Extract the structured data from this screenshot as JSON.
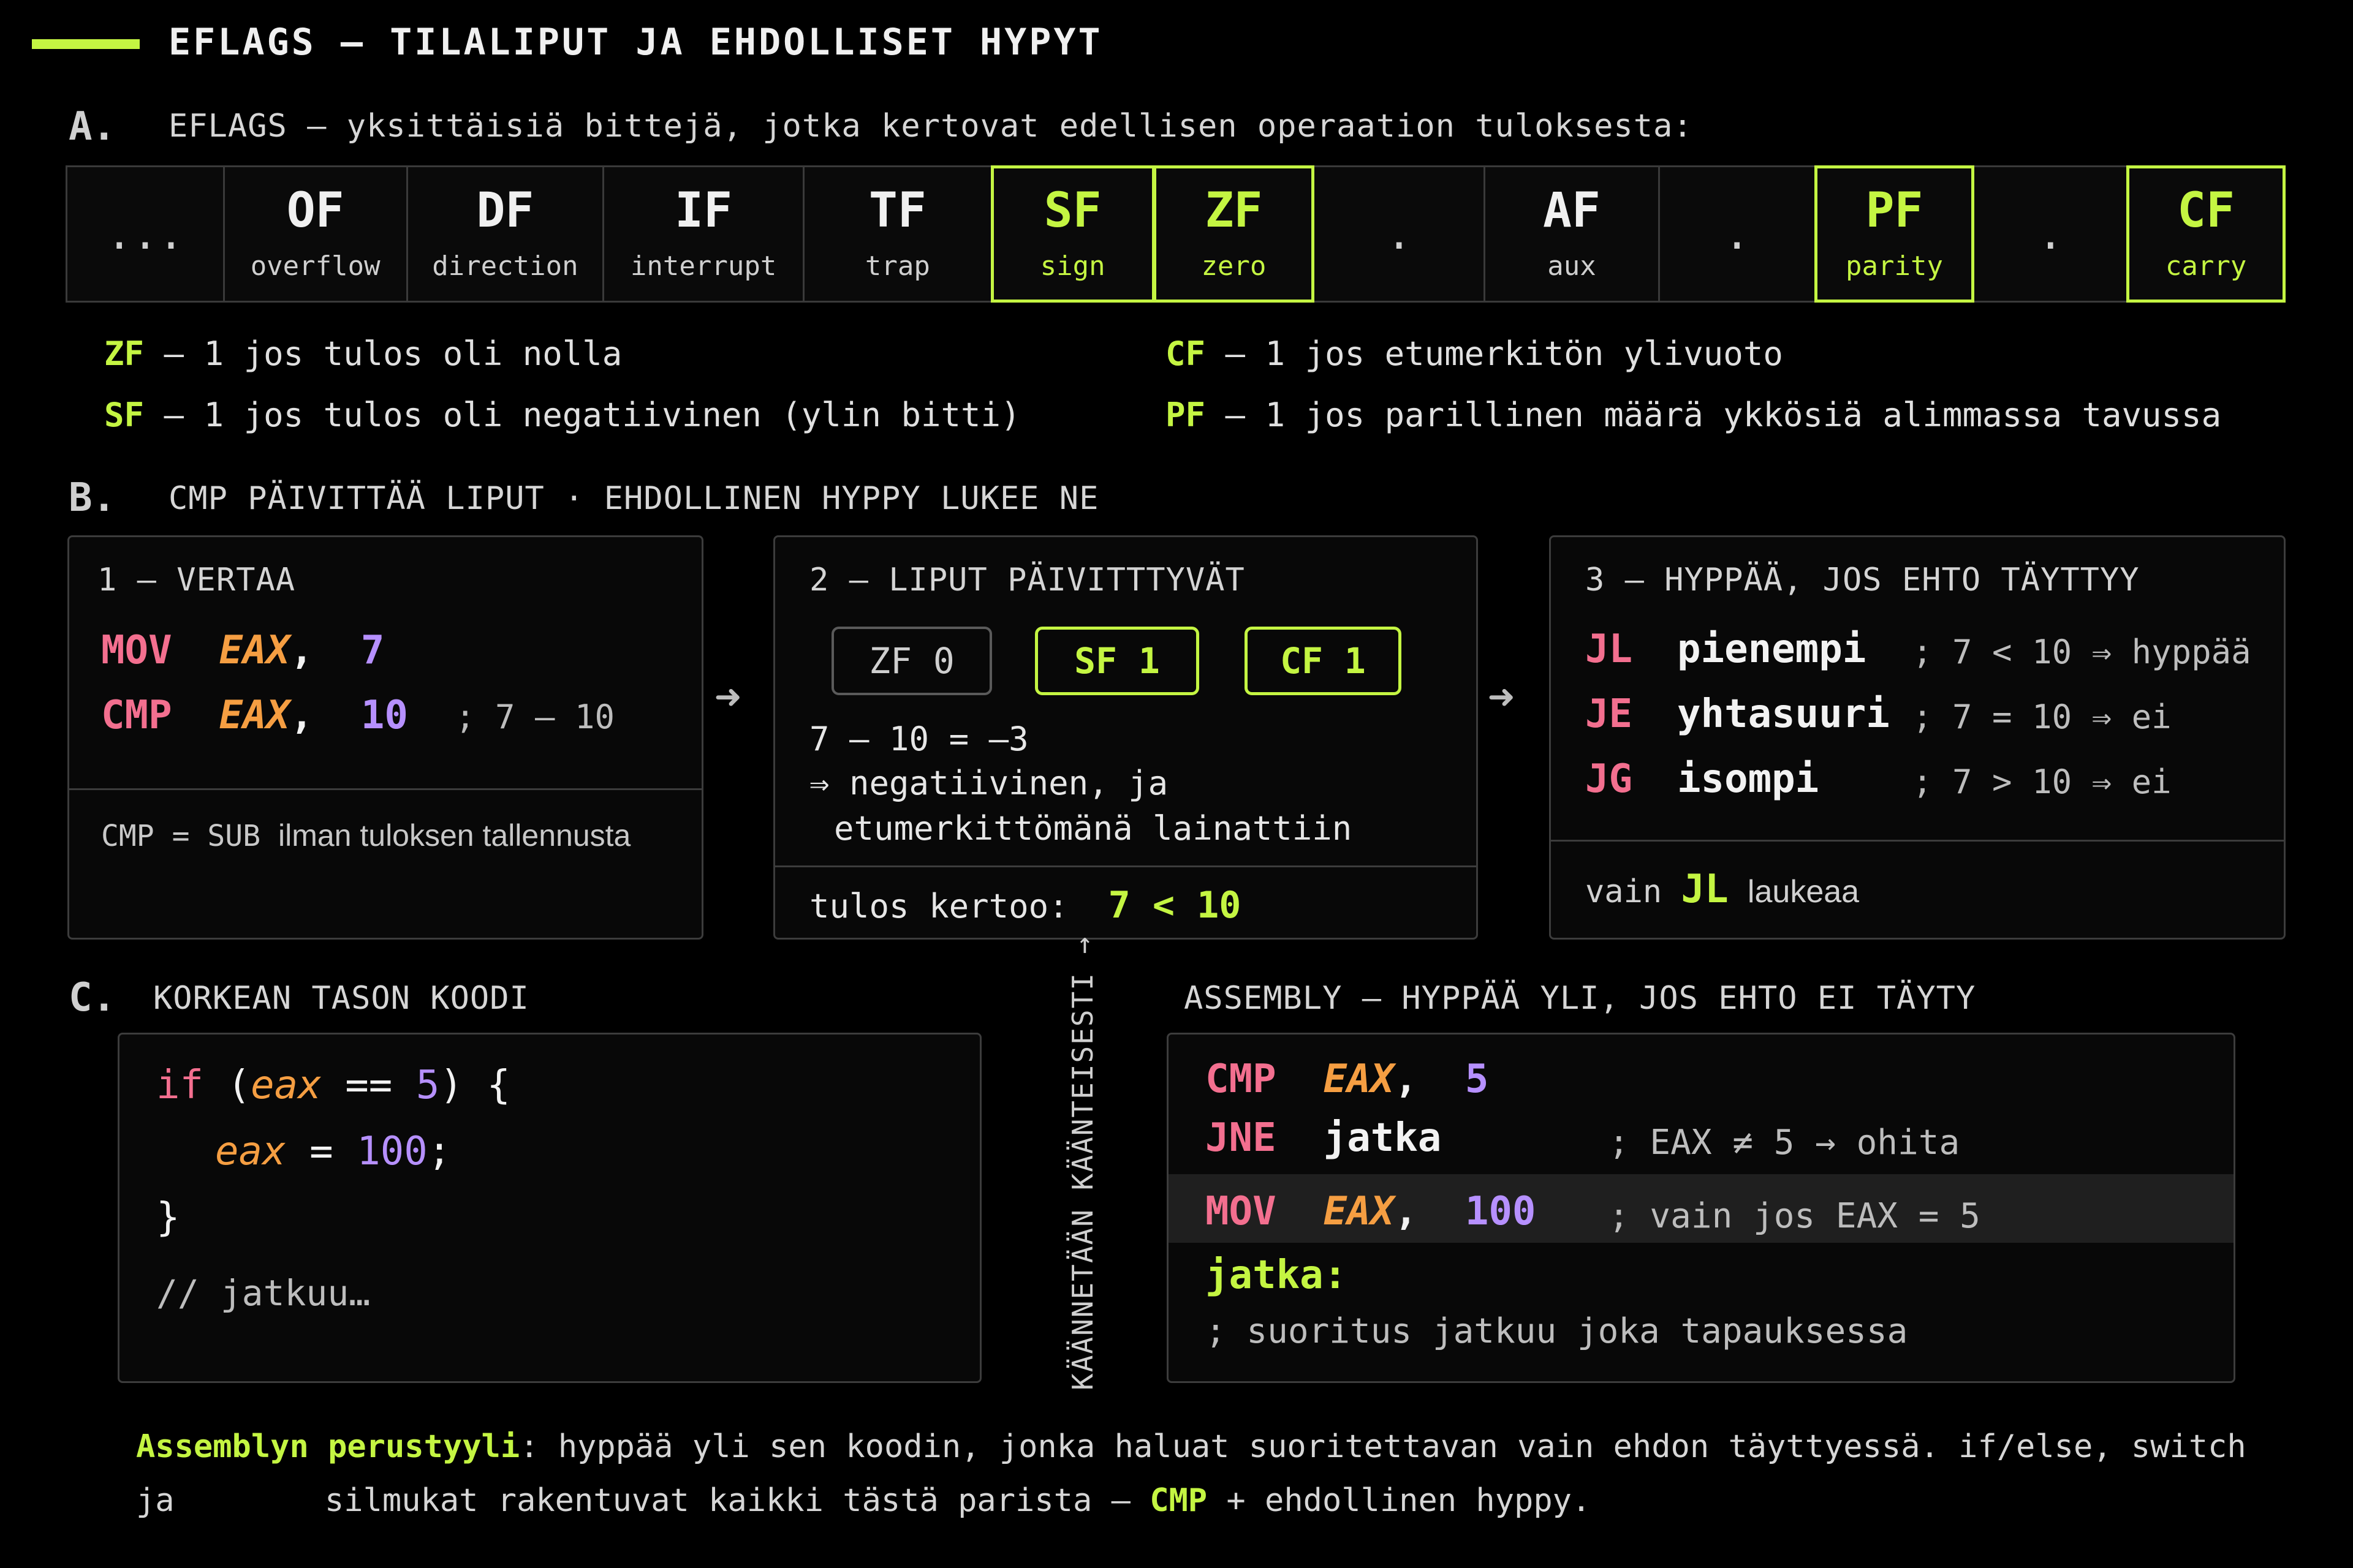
{
  "title": "EFLAGS — TILALIPUT JA EHDOLLISET HYPYT",
  "sectionA": {
    "letter": "A.",
    "heading": "EFLAGS – yksittäisiä bittejä, jotka kertovat edellisen operaation tuloksesta:",
    "flags": [
      {
        "name": "...",
        "label": "",
        "highlight": false
      },
      {
        "name": "OF",
        "label": "overflow",
        "highlight": false
      },
      {
        "name": "DF",
        "label": "direction",
        "highlight": false
      },
      {
        "name": "IF",
        "label": "interrupt",
        "highlight": false
      },
      {
        "name": "TF",
        "label": "trap",
        "highlight": false
      },
      {
        "name": "SF",
        "label": "sign",
        "highlight": true
      },
      {
        "name": "ZF",
        "label": "zero",
        "highlight": true
      },
      {
        "name": ".",
        "label": "",
        "highlight": false
      },
      {
        "name": "AF",
        "label": "aux",
        "highlight": false
      },
      {
        "name": ".",
        "label": "",
        "highlight": false
      },
      {
        "name": "PF",
        "label": "parity",
        "highlight": true
      },
      {
        "name": ".",
        "label": "",
        "highlight": false
      },
      {
        "name": "CF",
        "label": "carry",
        "highlight": true
      }
    ],
    "defs": {
      "zf_key": "ZF",
      "zf_text": " — 1 jos tulos oli nolla",
      "sf_key": "SF",
      "sf_text": " — 1 jos tulos oli negatiivinen (ylin bitti)",
      "cf_key": "CF",
      "cf_text": " — 1 jos etumerkitön ylivuoto",
      "pf_key": "PF",
      "pf_text": " — 1 jos parillinen määrä ykkösiä alimmassa tavussa"
    }
  },
  "sectionB": {
    "letter": "B.",
    "heading": "CMP PÄIVITTÄÄ LIPUT · EHDOLLINEN HYPPY LUKEE NE",
    "box1": {
      "head": "1 — VERTAA",
      "l1_op": "MOV",
      "l1_reg": "EAX",
      "l1_sep": ",",
      "l1_num": "7",
      "l2_op": "CMP",
      "l2_reg": "EAX",
      "l2_sep": ",",
      "l2_num": "10",
      "l2_cmt": "; 7 – 10",
      "foot_a": "CMP = SUB",
      "foot_b": "ilman tuloksen tallennusta"
    },
    "box2": {
      "head": "2 — LIPUT PÄIVITTTYVÄT",
      "pill1": "ZF 0",
      "pill2": "SF 1",
      "pill3": "CF 1",
      "line1": "7 – 10 = –3",
      "line2": "⇒ negatiivinen, ja",
      "line3": "etumerkittömänä lainattiin",
      "foot_a": "tulos kertoo:",
      "foot_b": "7 < 10"
    },
    "box3": {
      "head": "3 — HYPPÄÄ, JOS EHTO TÄYTTYY",
      "rows": [
        {
          "op": "JL",
          "label": "pienempi",
          "cmt": "; 7 < 10 ⇒ hyppää"
        },
        {
          "op": "JE",
          "label": "yhtasuuri",
          "cmt": "; 7 = 10 ⇒ ei"
        },
        {
          "op": "JG",
          "label": "isompi",
          "cmt": "; 7 > 10 ⇒ ei"
        }
      ],
      "foot_a": "vain",
      "foot_b": "JL",
      "foot_c": "laukeaa"
    },
    "arrow": "➜"
  },
  "sectionC": {
    "letter": "C.",
    "left_head": "KORKEAN TASON KOODI",
    "right_head": "ASSEMBLY — HYPPÄÄ YLI, JOS EHTO EI TÄYTY",
    "vertical": "KÄÄNNETÄÄN KÄÄNTEISESTI →",
    "hl": {
      "if_kw": "if",
      "p_open": " (",
      "var": "eax",
      "op": " == ",
      "num": "5",
      "p_close": ") {",
      "var2": "eax",
      "assign": " = ",
      "num2": "100",
      "semi": ";",
      "close": "}",
      "comment": "// jatkuu…"
    },
    "asm": {
      "r1_op": "CMP",
      "r1_reg": "EAX",
      "r1_sep": ",",
      "r1_num": "5",
      "r2_op": "JNE",
      "r2_lbl": "jatka",
      "r2_cmt": "; EAX ≠ 5 → ohita",
      "r3_op": "MOV",
      "r3_reg": "EAX",
      "r3_sep": ",",
      "r3_num": "100",
      "r3_cmt": "; vain jos EAX = 5",
      "r4_lbl": "jatka:",
      "r5_cmt": "; suoritus jatkuu joka tapauksessa"
    }
  },
  "footer": {
    "key": "Assemblyn perustyyli",
    "t1": ": hyppää yli sen koodin, jonka haluat suoritettavan vain ehdon täyttyessä. if/else, switch ja",
    "t2": "silmukat rakentuvat kaikki tästä parista — ",
    "cmp": "CMP",
    "t3": " + ehdollinen hyppy."
  }
}
